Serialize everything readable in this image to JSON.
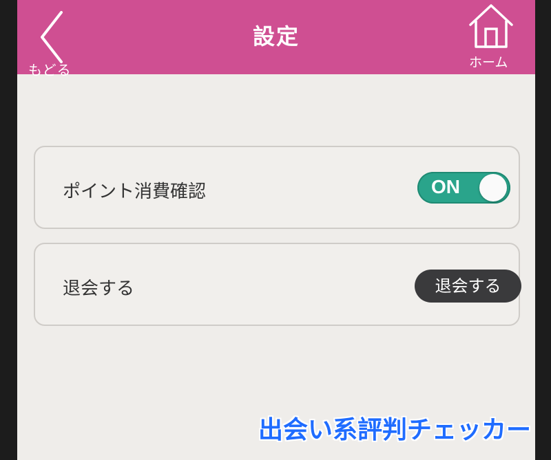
{
  "header": {
    "title": "設定",
    "back_label": "もどる",
    "home_label": "ホーム",
    "background": "#cf4f92"
  },
  "settings": {
    "point_confirm": {
      "label": "ポイント消費確認",
      "toggle_text": "ON",
      "toggle_on": true,
      "toggle_color": "#2aa48b"
    },
    "withdraw": {
      "label": "退会する",
      "button_label": "退会する"
    }
  },
  "watermark": {
    "text": "出会い系評判チェッカー",
    "color": "#1f6cff"
  }
}
